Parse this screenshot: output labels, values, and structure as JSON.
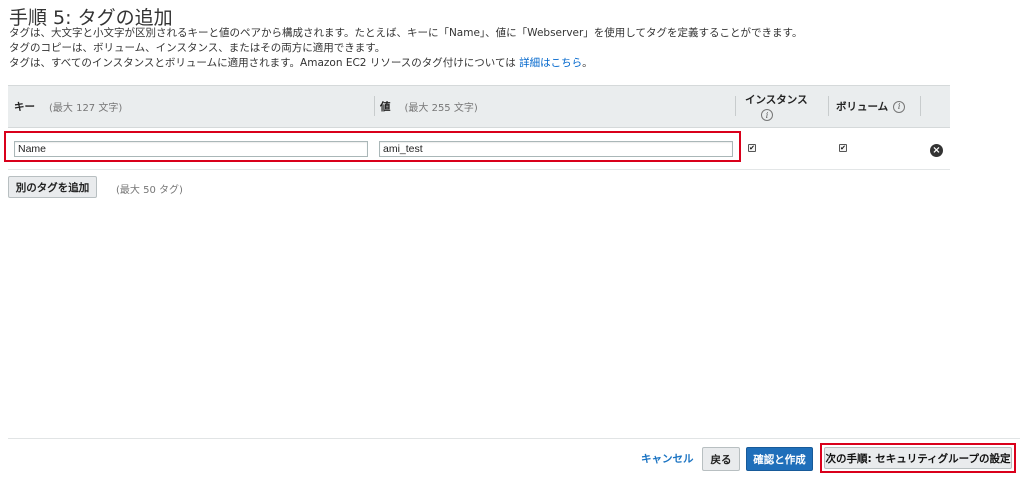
{
  "page": {
    "title": "手順 5: タグの追加",
    "description_line1": "タグは、大文字と小文字が区別されるキーと値のペアから構成されます。たとえば、キーに「Name」、値に「Webserver」を使用してタグを定義することができます。",
    "description_line2": "タグのコピーは、ボリューム、インスタンス、またはその両方に適用できます。",
    "description_line3_text": "タグは、すべてのインスタンスとボリュームに適用されます。Amazon EC2 リソースのタグ付けについては",
    "description_line3_link": "詳細はこちら",
    "description_line3_end": "。"
  },
  "table": {
    "headers": {
      "key_label": "キー",
      "key_hint": "(最大 127 文字)",
      "value_label": "値",
      "value_hint": "(最大 255 文字)",
      "instances_label": "インスタンス",
      "volumes_label": "ボリューム"
    },
    "rows": [
      {
        "key": "Name",
        "value": "ami_test",
        "instances_checked": true,
        "volumes_checked": true
      }
    ]
  },
  "actions": {
    "add_tag_label": "別のタグを追加",
    "add_tag_note": "(最大 50 タグ)",
    "cancel_label": "キャンセル",
    "back_label": "戻る",
    "review_label": "確認と作成",
    "next_label": "次の手順: セキュリティグループの設定"
  },
  "icons": {
    "info": "info-icon",
    "remove": "remove-icon",
    "checkbox": "checkbox-icon"
  },
  "colors": {
    "highlight": "#d9001b",
    "primary_button": "#1f6fba",
    "link": "#1a73c2",
    "header_bg": "#eaedee"
  }
}
